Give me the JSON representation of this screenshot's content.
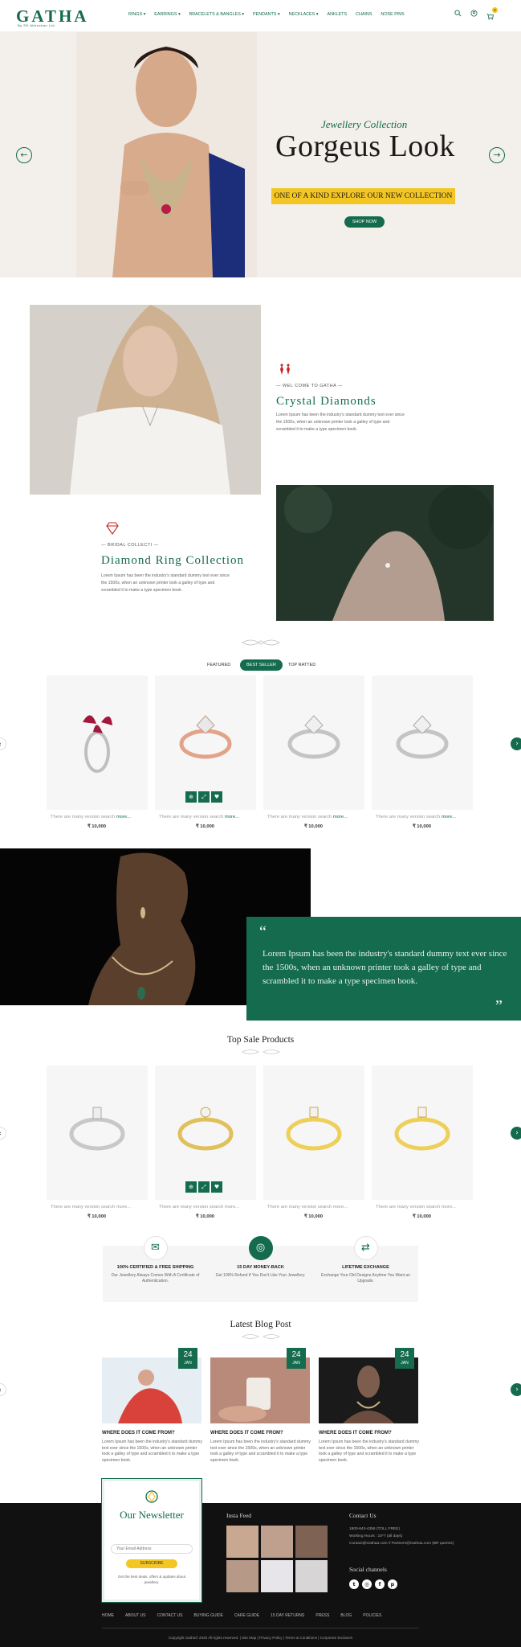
{
  "header": {
    "logo": "GATHA",
    "logo_sub": "By SD Abhushan Ltd.",
    "nav": [
      "RINGS",
      "EARRINGS",
      "BRACELETS & BANGLES",
      "PENDANTS",
      "NECKLACES",
      "ANKLETS",
      "CHAINS",
      "NOSE PINS"
    ],
    "cart_count": "0"
  },
  "hero": {
    "script": "Jewellery Collection",
    "title": "Gorgeus Look",
    "band": "ONE OF A KIND EXPLORE OUR NEW COLLECTION",
    "button": "SHOP NOW"
  },
  "about": {
    "label1": "WEL COME TO GATHA",
    "title1": "Crystal Diamonds",
    "para1": "Lorem Ipsum has been the industry's standard dummy text ever since the 1500s, when an unknown printer took a galley of type and scrambled it to make a type specimen book.",
    "label2": "BRIDAL COLLECTI",
    "title2": "Diamond Ring Collection",
    "para2": "Lorem Ipsum has been the industry's standard dummy text ever since the 1500s, when an unknown printer took a galley of type and scrambled it to make a type specimen book."
  },
  "tabs": [
    "FEATURED",
    "BEST SELLER",
    "TOP RATTED"
  ],
  "products1": [
    {
      "desc": "There are many version search ",
      "more": "more...",
      "price": "₹ 10,000"
    },
    {
      "desc": "There are many version search ",
      "more": "more...",
      "price": "₹ 10,000"
    },
    {
      "desc": "There are many version search ",
      "more": "more...",
      "price": "₹ 10,000"
    },
    {
      "desc": "There are many version search ",
      "more": "more...",
      "price": "₹ 10,000"
    }
  ],
  "testimonial": {
    "text": "Lorem Ipsum has been the industry's standard dummy text ever since the 1500s, when an unknown printer took a galley of type and scrambled it to make a type specimen book."
  },
  "top_sale": {
    "title": "Top Sale Products",
    "items": [
      {
        "desc": "There are many version search more...",
        "price": "₹ 10,000"
      },
      {
        "desc": "There are many version search more...",
        "price": "₹ 10,000"
      },
      {
        "desc": "There are many version search more...",
        "price": "₹ 10,000"
      },
      {
        "desc": "There are many version search more...",
        "price": "₹ 10,000"
      }
    ]
  },
  "features": [
    {
      "icon": "certificate-icon",
      "title": "100% CERTIFIED & FREE SHIPPING",
      "desc": "Our Jewellery Always Comes With A Certificate of Authentication."
    },
    {
      "icon": "money-back-icon",
      "title": "15 DAY MONEY-BACK",
      "desc": "Get 100% Refund If You Don't Like Your Jewellery."
    },
    {
      "icon": "exchange-icon",
      "title": "LIFETIME EXCHANGE",
      "desc": "Exchange Your Old Designs Anytime You Want an Upgrade."
    }
  ],
  "blog": {
    "title": "Latest Blog Post",
    "posts": [
      {
        "day": "24",
        "month": "JAN",
        "title": "WHERE DOES IT COME FROM?",
        "desc": "Lorem Ipsum has been the industry's standard dummy text ever since the 1500s, when an unknown printer took a galley of type and scrambled it to make a type specimen book."
      },
      {
        "day": "24",
        "month": "JAN",
        "title": "WHERE DOES IT COME FROM?",
        "desc": "Lorem Ipsum has been the industry's standard dummy text ever since the 1500s, when an unknown printer took a galley of type and scrambled it to make a type specimen book."
      },
      {
        "day": "24",
        "month": "JAN",
        "title": "WHERE DOES IT COME FROM?",
        "desc": "Lorem Ipsum has been the industry's standard dummy text ever since the 1500s, when an unknown printer took a galley of type and scrambled it to make a type specimen book."
      }
    ]
  },
  "newsletter": {
    "title": "Our Newsletter",
    "placeholder": "Your Email Address",
    "button": "SUBSCRIBE",
    "note": "Get the best deals, offers & updates about jewellery."
  },
  "footer": {
    "insta_title": "Insta Feed",
    "contact_title": "Contact Us",
    "phone": "1800-843-4356 (TOLL FREE)",
    "hours": "Working Hours : 10*7 (all days)",
    "email": "Contact@Gathaa.com // Partners@Gathaa.com (BR queries)",
    "social_title": "Social channels",
    "nav": [
      "HOME",
      "ABOUT US",
      "CONTACT US",
      "BUYING GUIDE",
      "CARE GUIDE",
      "15 DAY RETURNS",
      "PRESS",
      "BLOG",
      "POLICIES"
    ],
    "copyright": "Copyright Gatha© 2020 All rights reserved. | Site Map | Privacy Policy | Terms & Conditions | Corporate Enclaves"
  },
  "colors": {
    "brand": "#146b4d",
    "accent": "#f3c623",
    "footer": "#111111"
  }
}
